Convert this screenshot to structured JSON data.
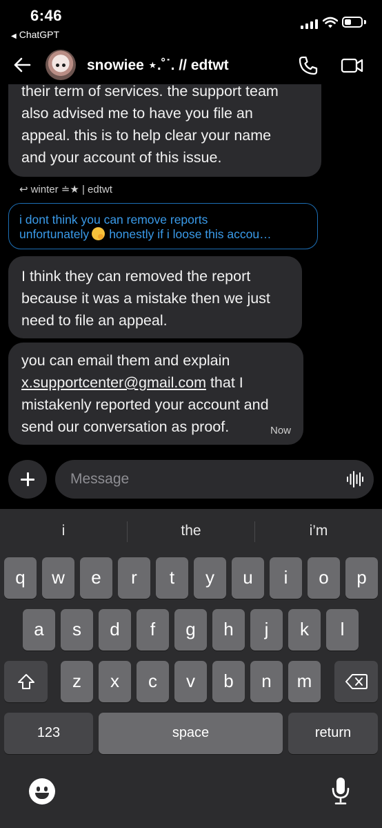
{
  "status_bar": {
    "time": "6:46",
    "back_app": "ChatGPT"
  },
  "header": {
    "name": "snowiee ⋆.˚˙. // edtwt"
  },
  "messages": {
    "m1": [
      "their term of services. the support team",
      "also advised me to have you file an",
      "appeal. this is to help clear your name",
      "and your account of this issue."
    ],
    "reply_to": "winter ≐★ | edtwt",
    "quoted": {
      "line1": "i dont think you can remove reports",
      "line2a": "unfortunately",
      "line2b": "honestly if i loose this accou…"
    },
    "m2": [
      "I think they can removed the report",
      "because it was a mistake then we just",
      "need to file an appeal."
    ],
    "m3": {
      "line1": "you can email them and explain",
      "email": "x.supportcenter@gmail.com",
      "line2_rest": " that I",
      "line3": "mistakenly reported your account and",
      "line4": "send our conversation as proof.",
      "timestamp": "Now"
    }
  },
  "composer": {
    "placeholder": "Message"
  },
  "keyboard": {
    "suggestions": [
      "i",
      "the",
      "i’m"
    ],
    "row1": [
      "q",
      "w",
      "e",
      "r",
      "t",
      "y",
      "u",
      "i",
      "o",
      "p"
    ],
    "row2": [
      "a",
      "s",
      "d",
      "f",
      "g",
      "h",
      "j",
      "k",
      "l"
    ],
    "row3": [
      "z",
      "x",
      "c",
      "v",
      "b",
      "n",
      "m"
    ],
    "numbers_key": "123",
    "space_key": "space",
    "return_key": "return"
  },
  "icons": {
    "back": "left-arrow-icon",
    "call": "phone-icon",
    "video": "video-camera-icon",
    "voice": "waveform-icon",
    "shift": "shift-arrow-icon",
    "delete": "backspace-icon",
    "emoji": "emoji-face-icon",
    "mic": "microphone-icon"
  },
  "colors": {
    "bubble": "#2b2b2e",
    "link": "#3a9bea",
    "keyboard_bg": "#2c2c2e",
    "key": "#6b6b6e"
  }
}
